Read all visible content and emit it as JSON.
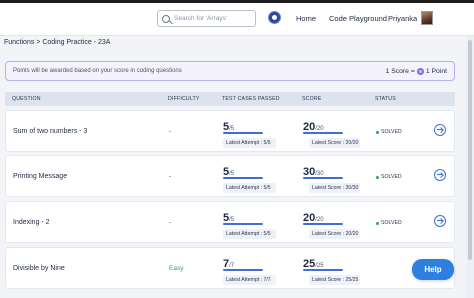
{
  "search": {
    "placeholder": "Search for 'Arrays'"
  },
  "nav": {
    "home": "Home",
    "playground": "Code Playground",
    "user": "Priyanka"
  },
  "breadcrumb": "Functions > Coding Practice - 23A",
  "note": {
    "text": "Points will be awarded based on your score in coding questions",
    "score_label": "1 Score =",
    "point_label": "1 Point"
  },
  "table": {
    "headers": {
      "question": "QUESTION",
      "difficulty": "DIFFICULTY",
      "tests": "TEST CASES PASSED",
      "score": "SCORE",
      "status": "STATUS"
    },
    "rows": [
      {
        "question": "Sum of two numbers - 3",
        "difficulty": "-",
        "tc_passed": "5",
        "tc_total": "/5",
        "tc_latest": "Latest Attempt : 5/5",
        "score": "20",
        "score_total": "/20",
        "score_latest": "Latest Score : 20/20",
        "status": "SOLVED"
      },
      {
        "question": "Printing Message",
        "difficulty": "-",
        "tc_passed": "5",
        "tc_total": "/5",
        "tc_latest": "Latest Attempt : 5/5",
        "score": "30",
        "score_total": "/30",
        "score_latest": "Latest Score : 30/30",
        "status": "SOLVED"
      },
      {
        "question": "Indexing - 2",
        "difficulty": "-",
        "tc_passed": "5",
        "tc_total": "/5",
        "tc_latest": "Latest Attempt : 5/5",
        "score": "20",
        "score_total": "/20",
        "score_latest": "Latest Score : 20/20",
        "status": "SOLVED"
      },
      {
        "question": "Divisible by Nine",
        "difficulty": "Easy",
        "tc_passed": "7",
        "tc_total": "/7",
        "tc_latest": "Latest Attempt : 7/7",
        "score": "25",
        "score_total": "/25",
        "score_latest": "Latest Score : 25/25",
        "status": "SOLVED"
      }
    ]
  },
  "help": "Help",
  "icons": {
    "search": "search-icon",
    "brand": "brand-logo-icon",
    "go": "arrow-right-circle-icon",
    "coin": "coin-icon"
  },
  "colors": {
    "accent": "#3d6fd6",
    "solved": "#2ea552",
    "easy": "#2ea552",
    "help": "#2f7fe0",
    "note_border": "#b5aef0"
  }
}
